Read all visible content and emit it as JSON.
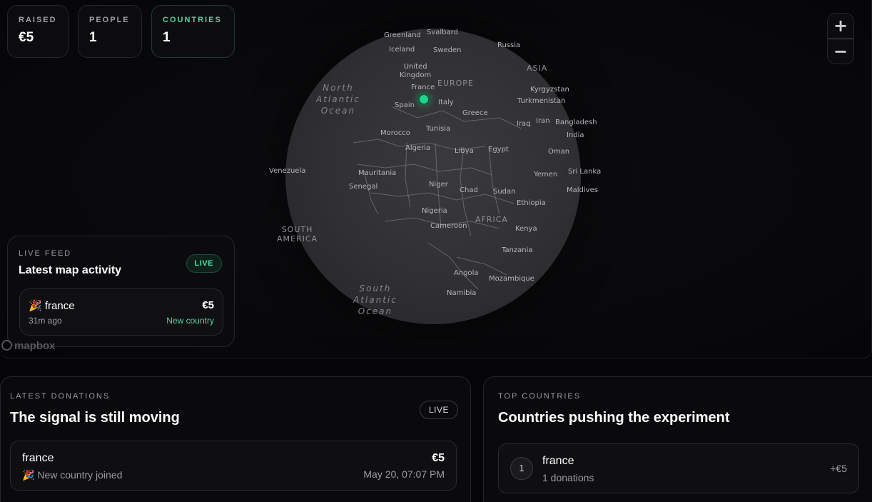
{
  "stats": [
    {
      "label": "RAISED",
      "value": "€5"
    },
    {
      "label": "PEOPLE",
      "value": "1"
    },
    {
      "label": "COUNTRIES",
      "value": "1"
    }
  ],
  "zoom": {
    "in": "+",
    "out": "−"
  },
  "map": {
    "attribution": "mapbox",
    "marker_color": "#22d38a",
    "labels": {
      "greenland": "Greenland",
      "svalbard": "Svalbard",
      "iceland": "Iceland",
      "sweden": "Sweden",
      "russia": "Russia",
      "united_kingdom": "United\nKingdom",
      "europe": "EUROPE",
      "asia": "ASIA",
      "france": "France",
      "italy": "Italy",
      "spain": "Spain",
      "greece": "Greece",
      "kyrgyzstan": "Kyrgyzstan",
      "turkmenistan": "Turkmenistan",
      "iran": "Iran",
      "iraq": "Iraq",
      "bangladesh": "Bangladesh",
      "india": "India",
      "morocco": "Morocco",
      "tunisia": "Tunisia",
      "algeria": "Algeria",
      "libya": "Libya",
      "egypt": "Egypt",
      "oman": "Oman",
      "venezuela": "Venezuela",
      "mauritania": "Mauritania",
      "yemen": "Yemen",
      "sri_lanka": "Sri Lanka",
      "senegal": "Senegal",
      "niger": "Niger",
      "chad": "Chad",
      "sudan": "Sudan",
      "maldives": "Maldives",
      "ethiopia": "Ethiopia",
      "nigeria": "Nigeria",
      "africa": "AFRICA",
      "south_america": "SOUTH\nAMERICA",
      "cameroon": "Cameroon",
      "kenya": "Kenya",
      "tanzania": "Tanzania",
      "angola": "Angola",
      "mozambique": "Mozambique",
      "namibia": "Namibia",
      "north_atlantic": "North\nAtlantic\nOcean",
      "south_atlantic": "South\nAtlantic\nOcean"
    }
  },
  "live_feed": {
    "eyebrow": "LIVE FEED",
    "title": "Latest map activity",
    "badge": "LIVE",
    "item": {
      "emoji": "🎉",
      "name": "france",
      "time": "31m ago",
      "amount": "€5",
      "tag": "New country"
    }
  },
  "latest_donations": {
    "eyebrow": "LATEST DONATIONS",
    "title": "The signal is still moving",
    "badge": "LIVE",
    "item": {
      "name": "france",
      "emoji": "🎉",
      "sub": "New country joined",
      "amount": "€5",
      "date": "May 20, 07:07 PM"
    }
  },
  "top_countries": {
    "eyebrow": "TOP COUNTRIES",
    "title": "Countries pushing the experiment",
    "item": {
      "rank": "1",
      "name": "france",
      "sub": "1 donations",
      "amount": "+€5"
    }
  }
}
